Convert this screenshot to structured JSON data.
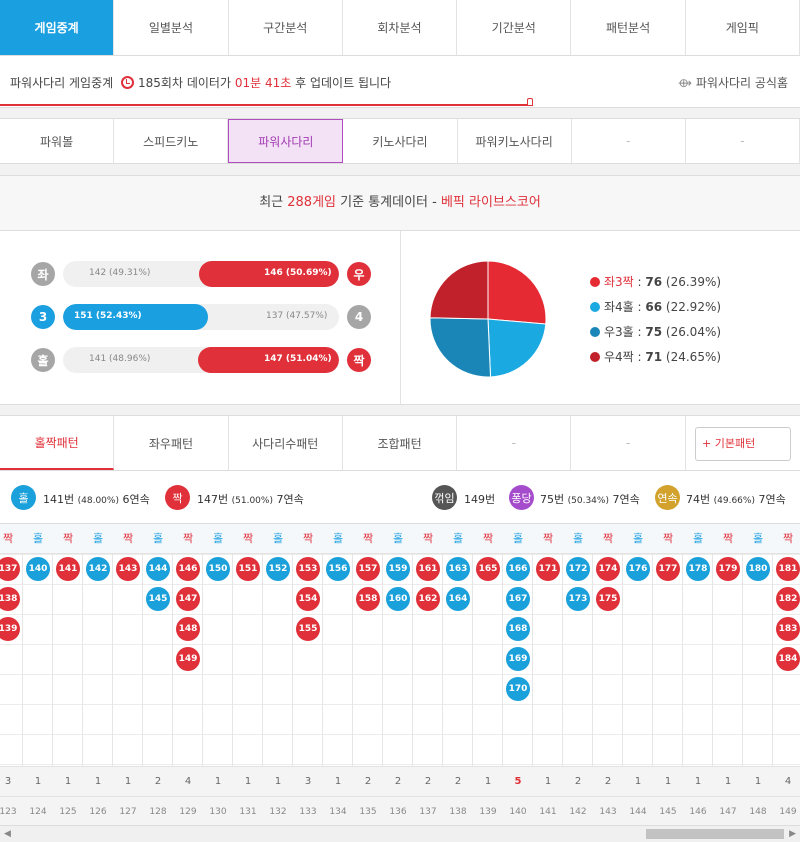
{
  "top_tabs": [
    "게임중계",
    "일별분석",
    "구간분석",
    "회차분석",
    "기간분석",
    "패턴분석",
    "게임픽"
  ],
  "info": {
    "prefix": "파워사다리 게임중계",
    "round": "185회차",
    "mid": "데이터가",
    "time": "01분 41초",
    "suffix": "후 업데이트 됩니다",
    "official": "파워사다리 공식홈"
  },
  "game_tabs": [
    "파워볼",
    "스피드키노",
    "파워사다리",
    "키노사다리",
    "파워키노사다리",
    "-",
    "-"
  ],
  "stats_header": {
    "pre": "최근",
    "count": "288게임",
    "mid": "기준 통계데이터 -",
    "brand": "베픽 라이브스코어"
  },
  "bars": [
    {
      "left_icon": "좌",
      "right_icon": "우",
      "left_text": "142 (49.31%)",
      "right_text": "146 (50.69%)",
      "left_pct": 49.31,
      "right_pct": 50.69,
      "winner": "right"
    },
    {
      "left_icon": "3",
      "right_icon": "4",
      "left_text": "151 (52.43%)",
      "right_text": "137 (47.57%)",
      "left_pct": 52.43,
      "right_pct": 47.57,
      "winner": "left"
    },
    {
      "left_icon": "홀",
      "right_icon": "짝",
      "left_text": "141 (48.96%)",
      "right_text": "147 (51.04%)",
      "left_pct": 48.96,
      "right_pct": 51.04,
      "winner": "right"
    }
  ],
  "pie": [
    {
      "label": "좌3짝",
      "value": 76,
      "pct": "26.39%",
      "color": "#e52a33"
    },
    {
      "label": "좌4홀",
      "value": 66,
      "pct": "22.92%",
      "color": "#1ba9e1"
    },
    {
      "label": "우3홀",
      "value": 75,
      "pct": "26.04%",
      "color": "#1a86b8"
    },
    {
      "label": "우4짝",
      "value": 71,
      "pct": "24.65%",
      "color": "#c1212a"
    }
  ],
  "pattern_tabs": [
    "홀짝패턴",
    "좌우패턴",
    "사다리수패턴",
    "조합패턴",
    "-",
    "-"
  ],
  "basic_pattern": "+ 기본패턴",
  "summary": {
    "odd_icon": "홀",
    "odd_count": "141번",
    "odd_pct": "(48.00%)",
    "odd_streak": "6연속",
    "even_icon": "짝",
    "even_count": "147번",
    "even_pct": "(51.00%)",
    "even_streak": "7연속",
    "break_icon": "꺾임",
    "break_count": "149번",
    "bounce_icon": "퐁당",
    "bounce_count": "75번",
    "bounce_pct": "(50.34%)",
    "bounce_streak": "7연속",
    "streak_icon": "연속",
    "streak_count": "74번",
    "streak_pct": "(49.66%)",
    "streak_streak": "7연속"
  },
  "pattern_columns": [
    {
      "type": "짝",
      "nums": [
        137,
        138,
        139
      ],
      "count": "3",
      "round": "123"
    },
    {
      "type": "홀",
      "nums": [
        140
      ],
      "count": "1",
      "round": "124"
    },
    {
      "type": "짝",
      "nums": [
        141
      ],
      "count": "1",
      "round": "125"
    },
    {
      "type": "홀",
      "nums": [
        142
      ],
      "count": "1",
      "round": "126"
    },
    {
      "type": "짝",
      "nums": [
        143
      ],
      "count": "1",
      "round": "127"
    },
    {
      "type": "홀",
      "nums": [
        144,
        145
      ],
      "count": "2",
      "round": "128"
    },
    {
      "type": "짝",
      "nums": [
        146,
        147,
        148,
        149
      ],
      "count": "4",
      "round": "129"
    },
    {
      "type": "홀",
      "nums": [
        150
      ],
      "count": "1",
      "round": "130"
    },
    {
      "type": "짝",
      "nums": [
        151
      ],
      "count": "1",
      "round": "131"
    },
    {
      "type": "홀",
      "nums": [
        152
      ],
      "count": "1",
      "round": "132"
    },
    {
      "type": "짝",
      "nums": [
        153,
        154,
        155
      ],
      "count": "3",
      "round": "133"
    },
    {
      "type": "홀",
      "nums": [
        156
      ],
      "count": "1",
      "round": "134"
    },
    {
      "type": "짝",
      "nums": [
        157,
        158
      ],
      "count": "2",
      "round": "135"
    },
    {
      "type": "홀",
      "nums": [
        159,
        160
      ],
      "count": "2",
      "round": "136"
    },
    {
      "type": "짝",
      "nums": [
        161,
        162
      ],
      "count": "2",
      "round": "137"
    },
    {
      "type": "홀",
      "nums": [
        163,
        164
      ],
      "count": "2",
      "round": "138"
    },
    {
      "type": "짝",
      "nums": [
        165
      ],
      "count": "1",
      "round": "139"
    },
    {
      "type": "홀",
      "nums": [
        166,
        167,
        168,
        169,
        170
      ],
      "count": "5",
      "round": "140"
    },
    {
      "type": "짝",
      "nums": [
        171
      ],
      "count": "1",
      "round": "141"
    },
    {
      "type": "홀",
      "nums": [
        172,
        173
      ],
      "count": "2",
      "round": "142"
    },
    {
      "type": "짝",
      "nums": [
        174,
        175
      ],
      "count": "2",
      "round": "143"
    },
    {
      "type": "홀",
      "nums": [
        176
      ],
      "count": "1",
      "round": "144"
    },
    {
      "type": "짝",
      "nums": [
        177
      ],
      "count": "1",
      "round": "145"
    },
    {
      "type": "홀",
      "nums": [
        178
      ],
      "count": "1",
      "round": "146"
    },
    {
      "type": "짝",
      "nums": [
        179
      ],
      "count": "1",
      "round": "147"
    },
    {
      "type": "홀",
      "nums": [
        180
      ],
      "count": "1",
      "round": "148"
    },
    {
      "type": "짝",
      "nums": [
        181,
        182,
        183,
        184
      ],
      "count": "4",
      "round": "149"
    }
  ],
  "colors": {
    "blue": "#1a9fe0",
    "red": "#e0303a",
    "purple": "#a23cb3"
  }
}
